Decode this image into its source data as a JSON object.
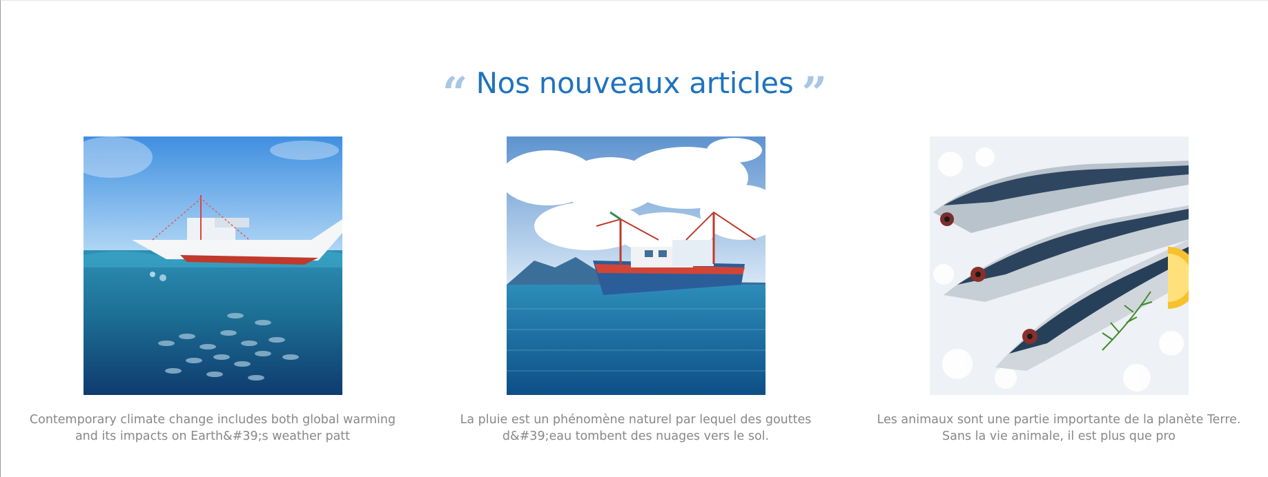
{
  "section": {
    "title": "Nos nouveaux articles",
    "open_quote": "“",
    "close_quote": "”"
  },
  "articles": [
    {
      "image": "boat-underwater-fish-school",
      "excerpt": "Contemporary climate change includes both global warming and its impacts on Earth&#39;s weather patt"
    },
    {
      "image": "fishing-trawler-at-sea",
      "excerpt": "La pluie est un phénomène naturel par lequel des gouttes d&#39;eau tombent des nuages vers le sol."
    },
    {
      "image": "mackerel-on-ice-with-lemon",
      "excerpt": "Les animaux sont une partie importante de la planète Terre. Sans la vie animale, il est plus que pro"
    }
  ],
  "colors": {
    "accent": "#1e73be",
    "quote": "#a9c6e6",
    "text": "#888888"
  }
}
